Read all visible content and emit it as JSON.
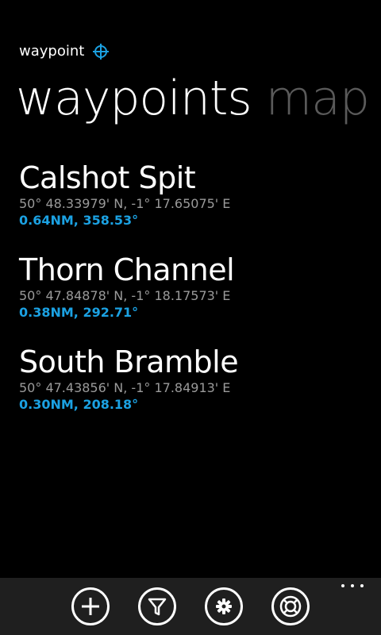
{
  "app": {
    "title": "waypoint",
    "icon": "crosshair-icon",
    "accent_color": "#1ba1e2"
  },
  "pivot": {
    "active": "waypoints",
    "next": "map"
  },
  "waypoints": [
    {
      "name": "Calshot Spit",
      "coords": "50° 48.33979' N, -1° 17.65075' E",
      "nav": "0.64NM, 358.53°"
    },
    {
      "name": "Thorn Channel",
      "coords": "50° 47.84878' N, -1° 18.17573' E",
      "nav": "0.38NM, 292.71°"
    },
    {
      "name": "South Bramble",
      "coords": "50° 47.43856' N, -1° 17.84913' E",
      "nav": "0.30NM, 208.18°"
    }
  ],
  "appbar": {
    "buttons": [
      "add-icon",
      "filter-icon",
      "settings-icon",
      "help-icon"
    ],
    "more": "more-options-icon"
  }
}
